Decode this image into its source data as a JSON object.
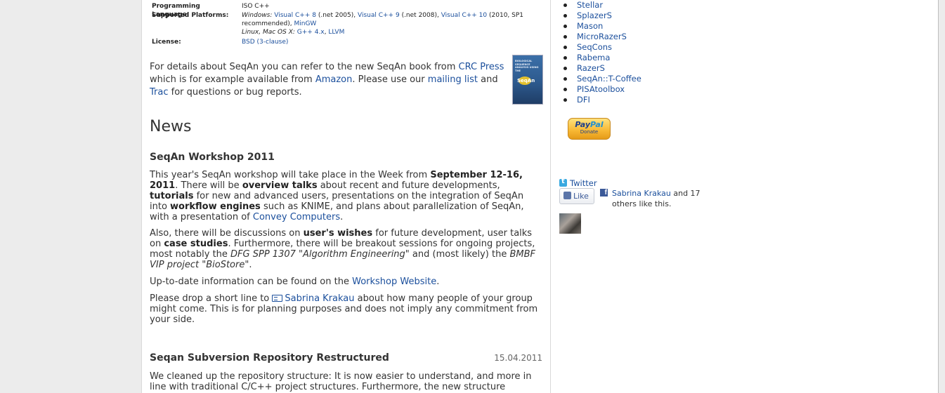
{
  "info": {
    "rows": [
      {
        "key": "Programming Language:",
        "value": "ISO C++"
      },
      {
        "key": "Supported Platforms:"
      },
      {
        "key": "License:",
        "value": "BSD (3-clause)"
      }
    ],
    "platforms": {
      "windows_label": "Windows:",
      "vc8": "Visual C++ 8",
      "vc8_note": "(.net 2005),",
      "vc9": "Visual C++ 9",
      "vc9_note": "(.net 2008),",
      "vc10": "Visual C++ 10",
      "vc10_note": "(2010, SP1",
      "line2_note": "recommended),",
      "mingw": "MinGW",
      "unix_label": "Linux, Mac OS X:",
      "gpp": "G++ 4.x",
      "sep": ",",
      "llvm": "LLVM"
    }
  },
  "book": {
    "text1": "For details about SeqAn you can refer to the new SeqAn book from",
    "crc_link": "CRC Press",
    "text2": "which is for example available from",
    "amazon_link": "Amazon",
    "text3": ". Please use our",
    "mailing_link": "mailing list",
    "text4": "and",
    "trac_link": "Trac",
    "text5": "for questions or bug reports.",
    "cover_text": "BIOLOGICAL SEQUENCE ANALYSIS USING THE",
    "cover_brand": "SeqAn"
  },
  "news": {
    "heading": "News",
    "post1": {
      "title": "SeqAn Workshop 2011",
      "p1": {
        "a": "This year's SeqAn workshop will take place in the Week from",
        "b": "September 12-16, 2011",
        "c": ". There will be",
        "d": "overview talks",
        "e": "about recent and future developments,",
        "f": "tutorials",
        "g": "for new and advanced users, presentations on the integration of SeqAn into",
        "h": "workflow engines",
        "i": "such as KNIME, and plans about parallelization of SeqAn, with a presentation of",
        "link": "Convey Computers",
        "j": "."
      },
      "p2": {
        "a": "Also, there will be discussions on",
        "b": "user's wishes",
        "c": "for future development, user talks on",
        "d": "case studies",
        "e": ". Furthermore, there will be breakout sessions for ongoing projects, most notably the",
        "f": "DFG SPP 1307 \"Algorithm Engineering\"",
        "g": "and (most likely) the",
        "h": "BMBF VIP project \"BioStore\"",
        "i": "."
      },
      "p3": {
        "a": "Up-to-date information can be found on the",
        "link": "Workshop Website",
        "b": "."
      },
      "p4": {
        "a": "Please drop a short line to",
        "link": "Sabrina Krakau",
        "b": "about how many people of your group might come. This is for planning purposes and does not imply any commitment from your side."
      }
    },
    "post2": {
      "title": "Seqan Subversion Repository Restructured",
      "date": "15.04.2011",
      "p1": "We cleaned up the repository structure: It is now easier to understand, and more in line with traditional C/C++ project structures. Furthermore, the new structure"
    }
  },
  "sidebar": {
    "tools": [
      "Stellar",
      "SplazerS",
      "Mason",
      "MicroRazerS",
      "SeqCons",
      "Rabema",
      "RazerS",
      "SeqAn::T-Coffee",
      "PISAtoolbox",
      "DFI"
    ],
    "paypal": {
      "brand_a": "Pay",
      "brand_b": "Pal",
      "label": "Donate"
    },
    "twitter": "Twitter",
    "like_label": "Like",
    "fb_logo": "f",
    "fb_person": "Sabrina Krakau",
    "fb_text": "and 17 others like this."
  }
}
